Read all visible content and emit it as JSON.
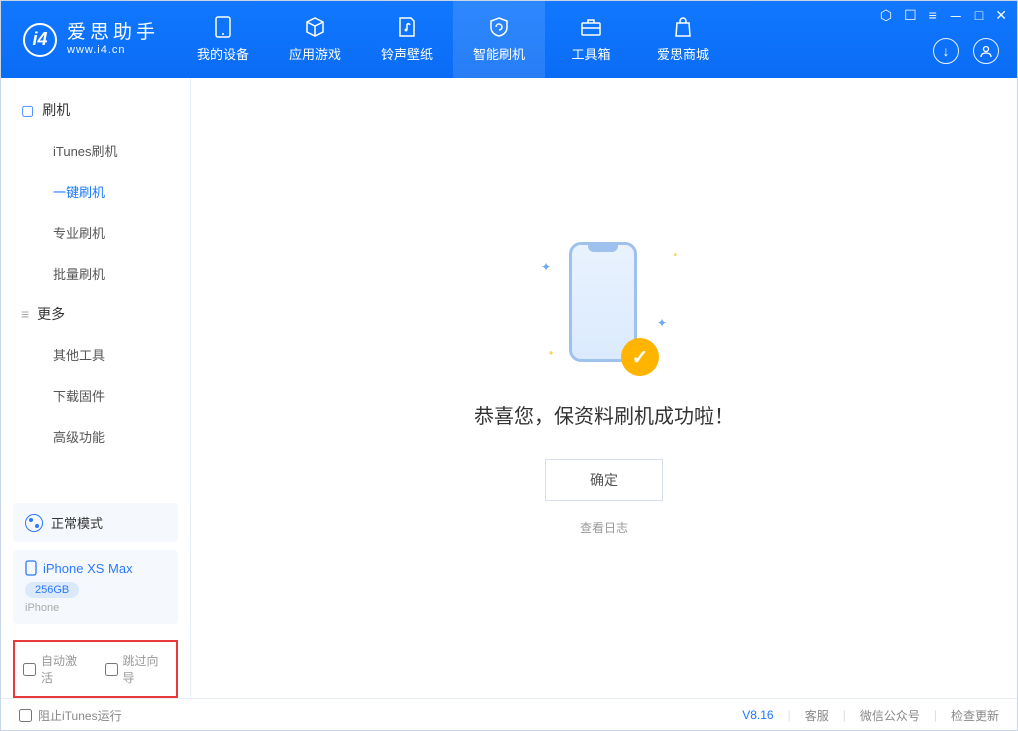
{
  "app": {
    "name": "爱思助手",
    "url": "www.i4.cn"
  },
  "nav": {
    "items": [
      {
        "label": "我的设备"
      },
      {
        "label": "应用游戏"
      },
      {
        "label": "铃声壁纸"
      },
      {
        "label": "智能刷机"
      },
      {
        "label": "工具箱"
      },
      {
        "label": "爱思商城"
      }
    ],
    "active_index": 3
  },
  "sidebar": {
    "group1": {
      "title": "刷机",
      "items": [
        "iTunes刷机",
        "一键刷机",
        "专业刷机",
        "批量刷机"
      ],
      "active_index": 1
    },
    "group2": {
      "title": "更多",
      "items": [
        "其他工具",
        "下载固件",
        "高级功能"
      ]
    },
    "mode": "正常模式",
    "device": {
      "name": "iPhone XS Max",
      "capacity": "256GB",
      "type": "iPhone"
    },
    "checkboxes": {
      "auto_activate": "自动激活",
      "skip_guide": "跳过向导"
    }
  },
  "main": {
    "success_text": "恭喜您，保资料刷机成功啦！",
    "ok_button": "确定",
    "view_log": "查看日志"
  },
  "footer": {
    "block_itunes": "阻止iTunes运行",
    "version": "V8.16",
    "links": [
      "客服",
      "微信公众号",
      "检查更新"
    ]
  }
}
